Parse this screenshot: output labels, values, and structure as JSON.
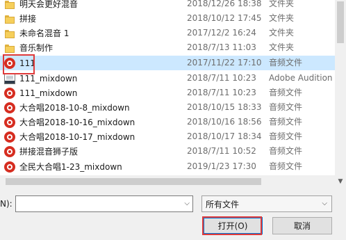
{
  "files": [
    {
      "name": "明天会更好混音",
      "date": "2018/12/26 18:38",
      "type": "文件夹",
      "icon": "folder-icon"
    },
    {
      "name": "拼接",
      "date": "2018/10/12 17:45",
      "type": "文件夹",
      "icon": "folder-icon"
    },
    {
      "name": "未命名混音 1",
      "date": "2017/12/2 16:24",
      "type": "文件夹",
      "icon": "folder-icon"
    },
    {
      "name": "音乐制作",
      "date": "2018/7/13 11:03",
      "type": "文件夹",
      "icon": "folder-icon"
    },
    {
      "name": "111",
      "date": "2017/11/22 17:10",
      "type": "音频文件",
      "icon": "audio-file-icon"
    },
    {
      "name": "111_mixdown",
      "date": "2018/7/11 10:23",
      "type": "Adobe Audition",
      "icon": "audition-file-icon"
    },
    {
      "name": "111_mixdown",
      "date": "2018/7/11 10:23",
      "type": "音频文件",
      "icon": "audio-file-icon"
    },
    {
      "name": "大合唱2018-10-8_mixdown",
      "date": "2018/10/15 18:33",
      "type": "音频文件",
      "icon": "audio-file-icon"
    },
    {
      "name": "大合唱2018-10-16_mixdown",
      "date": "2018/10/16 18:56",
      "type": "音频文件",
      "icon": "audio-file-icon"
    },
    {
      "name": "大合唱2018-10-17_mixdown",
      "date": "2018/10/17 18:34",
      "type": "音频文件",
      "icon": "audio-file-icon"
    },
    {
      "name": "拼接混音狮子版",
      "date": "2018/7/11 10:52",
      "type": "音频文件",
      "icon": "audio-file-icon"
    },
    {
      "name": "全民大合唱1-23_mixdown",
      "date": "2019/1/23 17:30",
      "type": "音频文件",
      "icon": "audio-file-icon"
    }
  ],
  "bottom": {
    "filename_label": "N):",
    "filename_value": "",
    "filetype_value": "所有文件",
    "open_label": "打开(O)",
    "cancel_label": "取消"
  },
  "colors": {
    "selection": "#cce8ff",
    "annotation_red": "#e03a3a",
    "audio_icon_red": "#d62d20",
    "default_button_border": "#0078d7"
  }
}
